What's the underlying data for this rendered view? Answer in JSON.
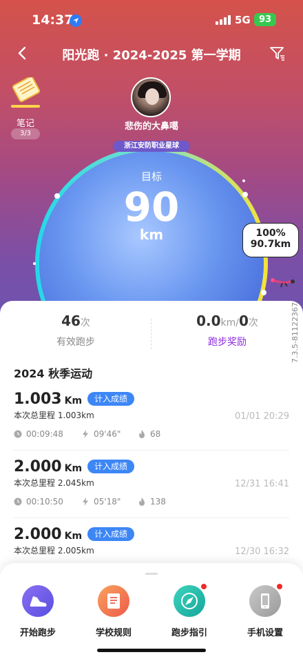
{
  "status_bar": {
    "time": "14:37",
    "network": "5G",
    "battery": "93"
  },
  "header": {
    "title": "阳光跑 · 2024-2025 第一学期"
  },
  "notes": {
    "label": "笔记",
    "count": "3/3"
  },
  "profile": {
    "name": "悲伤的大鼻噶",
    "school": "浙江安防职业星球"
  },
  "goal": {
    "label": "目标",
    "value": "90",
    "unit": "km",
    "progress_percent": "100%",
    "progress_km": "90.7km",
    "progress_fraction": 1.0
  },
  "stats": {
    "valid_runs": {
      "value": "46",
      "unit": "次",
      "label": "有效跑步"
    },
    "rewards": {
      "km": "0.0",
      "km_unit": "km",
      "sep": "/",
      "count": "0",
      "count_unit": "次",
      "label": "跑步奖励"
    }
  },
  "version": "7.3.5-81122367",
  "section_title": "2024 秋季运动",
  "records": [
    {
      "distance": "1.003",
      "unit": "Km",
      "tag": "计入成绩",
      "total": "本次总里程 1.003km",
      "date": "01/01 20:29",
      "duration": "00:09:48",
      "pace": "09'46\"",
      "calories": "68"
    },
    {
      "distance": "2.000",
      "unit": "Km",
      "tag": "计入成绩",
      "total": "本次总里程 2.045km",
      "date": "12/31 16:41",
      "duration": "00:10:50",
      "pace": "05'18\"",
      "calories": "138"
    },
    {
      "distance": "2.000",
      "unit": "Km",
      "tag": "计入成绩",
      "total": "本次总里程 2.005km",
      "date": "12/30 16:32"
    }
  ],
  "bottom_nav": [
    {
      "label": "开始跑步",
      "icon": "shoe-icon",
      "color": "#6b5be6"
    },
    {
      "label": "学校规则",
      "icon": "rules-book-icon",
      "color": "#f26a4b"
    },
    {
      "label": "跑步指引",
      "icon": "compass-icon",
      "color": "#1fb5a5"
    },
    {
      "label": "手机设置",
      "icon": "phone-icon",
      "color": "#a7a7a7"
    }
  ],
  "colors": {
    "accent_blue": "#3d86f5",
    "reward_purple": "#8b2ae0",
    "notify_red": "#f02b2b"
  }
}
